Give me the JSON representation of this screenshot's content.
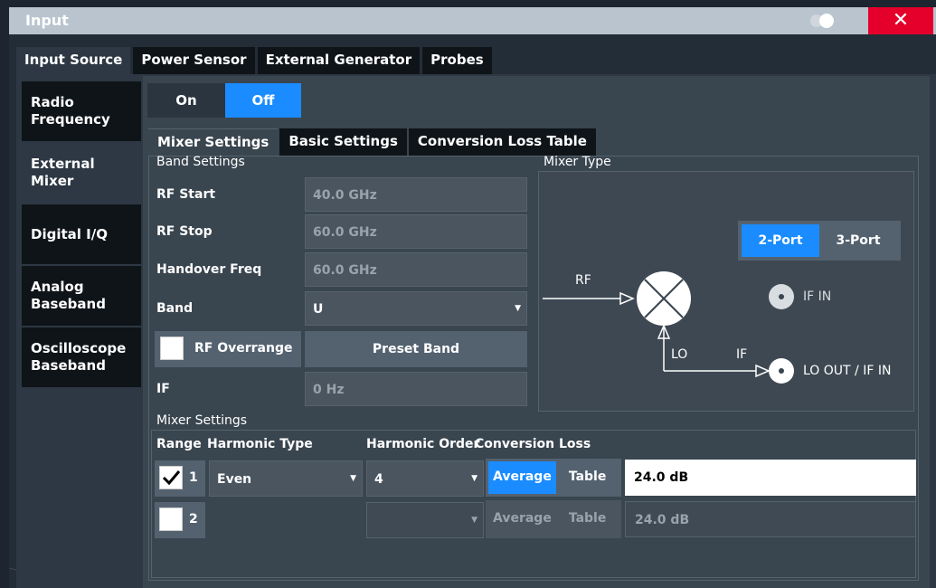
{
  "window": {
    "title": "Input",
    "close_label": "✕"
  },
  "top_tabs": [
    {
      "label": "Input Source",
      "active": true
    },
    {
      "label": "Power Sensor",
      "active": false
    },
    {
      "label": "External Generator",
      "active": false
    },
    {
      "label": "Probes",
      "active": false
    }
  ],
  "side_tabs": [
    {
      "label": "Radio Frequency",
      "active": false
    },
    {
      "label": "External Mixer",
      "active": true
    },
    {
      "label": "Digital I/Q",
      "active": false
    },
    {
      "label": "Analog Baseband",
      "active": false
    },
    {
      "label": "Oscilloscope Baseband",
      "active": false
    }
  ],
  "state": {
    "on_label": "On",
    "off_label": "Off",
    "selected": "Off"
  },
  "sub_tabs": [
    {
      "label": "Mixer Settings",
      "active": true
    },
    {
      "label": "Basic Settings",
      "active": false
    },
    {
      "label": "Conversion Loss Table",
      "active": false
    }
  ],
  "band_settings": {
    "group_label": "Band Settings",
    "rf_start_label": "RF Start",
    "rf_start_value": "40.0 GHz",
    "rf_stop_label": "RF Stop",
    "rf_stop_value": "60.0 GHz",
    "handover_label": "Handover Freq",
    "handover_value": "60.0 GHz",
    "band_label": "Band",
    "band_value": "U",
    "rf_overrange_label": "RF Overrange",
    "rf_overrange_checked": false,
    "preset_band_label": "Preset Band",
    "if_label": "IF",
    "if_value": "0 Hz"
  },
  "mixer_type": {
    "group_label": "Mixer Type",
    "port2_label": "2-Port",
    "port3_label": "3-Port",
    "selected": "2-Port",
    "rf_label": "RF",
    "lo_label": "LO",
    "if_label": "IF",
    "if_in_label": "IF IN",
    "lo_out_label": "LO OUT / IF IN"
  },
  "mixer_settings": {
    "group_label": "Mixer Settings",
    "headers": {
      "range": "Range",
      "harmonic_type": "Harmonic Type",
      "harmonic_order": "Harmonic Order",
      "conversion_loss": "Conversion Loss"
    },
    "rows": [
      {
        "checked": true,
        "range": "1",
        "harmonic_type": "Even",
        "harmonic_order": "4",
        "avg_label": "Average",
        "table_label": "Table",
        "loss": "24.0 dB"
      },
      {
        "checked": false,
        "range": "2",
        "harmonic_type": "",
        "harmonic_order": "",
        "avg_label": "Average",
        "table_label": "Table",
        "loss": "24.0 dB"
      }
    ]
  },
  "icons": {
    "toggle": "toggle-icon",
    "close": "close-icon",
    "dropdown": "chevron-down-icon",
    "check": "check-icon"
  }
}
